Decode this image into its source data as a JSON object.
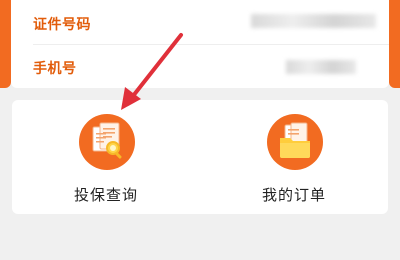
{
  "colors": {
    "accent": "#f26b21",
    "label": "#e25c0a",
    "arrow": "#e0303a",
    "card": "#ffffff",
    "background": "#f0f0f0"
  },
  "info": {
    "rows": [
      {
        "label": "证件号码",
        "value": ""
      },
      {
        "label": "手机号",
        "value": ""
      }
    ]
  },
  "actions": [
    {
      "label": "投保查询",
      "icon": "document-search-icon"
    },
    {
      "label": "我的订单",
      "icon": "folder-documents-icon"
    }
  ],
  "annotation": {
    "icon": "red-pointer-arrow"
  }
}
